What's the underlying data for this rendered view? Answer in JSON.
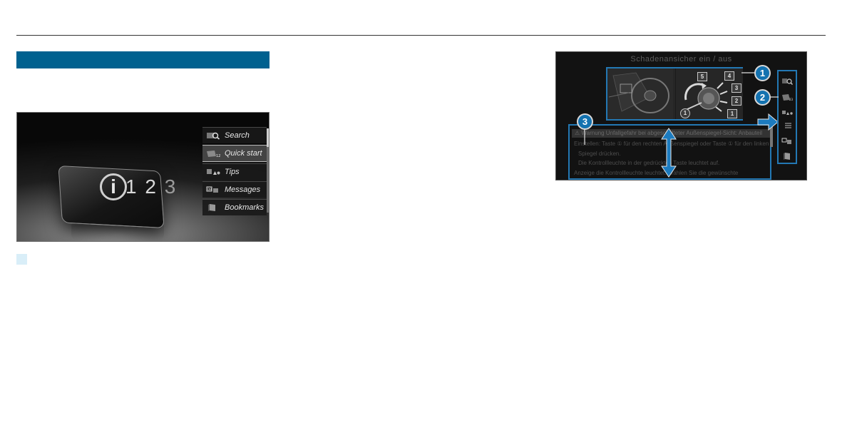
{
  "left_screen": {
    "card": {
      "info_letter": "i",
      "digits": [
        "1",
        "2",
        "3"
      ]
    },
    "menu": [
      {
        "label": "Search",
        "icon": "search-icon",
        "active": false
      },
      {
        "label": "Quick start",
        "icon": "quick-start-icon",
        "active": true
      },
      {
        "label": "Tips",
        "icon": "tips-icon",
        "active": false
      },
      {
        "label": "Messages",
        "icon": "messages-icon",
        "active": false
      },
      {
        "label": "Bookmarks",
        "icon": "bookmark-icon",
        "active": false
      }
    ]
  },
  "right_screen": {
    "title": "Schadenansicher ein / aus",
    "illustration_labels": [
      "5",
      "4",
      "3",
      "2",
      "1",
      "1"
    ],
    "text_lines": [
      "Warnung  Unfallgefahr bei abgeschalteter Außenspiegel-Sicht: Anbauteil",
      "Einstellen: Taste ① für den rechten Außenspiegel oder Taste ① für den linken",
      "Spiegel drücken.",
      "Die Kontrollleuchte in der gedrückten Taste leuchtet auf.",
      "Anzeige die Kontrollleuchte leuchtet: Wählen Sie die gewünschte"
    ],
    "side_icons": [
      "search-icon",
      "quick-start-icon",
      "tips-icon",
      "menu-icon",
      "messages-icon",
      "bookmark-icon"
    ],
    "callouts": [
      "1",
      "2",
      "3"
    ]
  },
  "colors": {
    "accent_blue": "#00618f",
    "highlight_blue": "#2378b4",
    "callout_blue": "#1372b0"
  }
}
